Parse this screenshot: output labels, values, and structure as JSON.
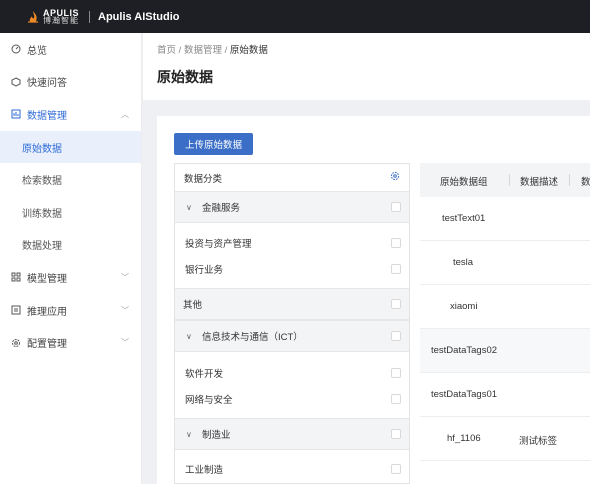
{
  "topbar": {
    "logo_en": "APULIS",
    "logo_cn": "博瀚智能",
    "app_title": "Apulis AIStudio"
  },
  "sidebar": {
    "items": [
      {
        "label": "总览",
        "icon": "dashboard-icon"
      },
      {
        "label": "快速问答",
        "icon": "chat-icon"
      },
      {
        "label": "数据管理",
        "icon": "data-icon",
        "expanded": true
      },
      {
        "label": "原始数据",
        "sub": true,
        "selected": true
      },
      {
        "label": "检索数据",
        "sub": true
      },
      {
        "label": "训练数据",
        "sub": true
      },
      {
        "label": "数据处理",
        "sub": true
      },
      {
        "label": "模型管理",
        "icon": "model-icon"
      },
      {
        "label": "推理应用",
        "icon": "inference-icon"
      },
      {
        "label": "配置管理",
        "icon": "settings-icon"
      }
    ]
  },
  "breadcrumb": {
    "home": "首页",
    "sep": "/",
    "parent": "数据管理",
    "current": "原始数据"
  },
  "page_title": "原始数据",
  "upload_button": "上传原始数据",
  "category_panel": {
    "header": "数据分类",
    "rows": [
      {
        "label": "金融服务",
        "type": "group"
      },
      {
        "label": "投资与资产管理",
        "type": "item"
      },
      {
        "label": "银行业务",
        "type": "item"
      },
      {
        "label": "其他",
        "type": "group-plain"
      },
      {
        "label": "信息技术与通信（ICT）",
        "type": "group"
      },
      {
        "label": "软件开发",
        "type": "item"
      },
      {
        "label": "网络与安全",
        "type": "item"
      },
      {
        "label": "制造业",
        "type": "group"
      },
      {
        "label": "工业制造",
        "type": "item"
      }
    ]
  },
  "table": {
    "columns": [
      "原始数据组",
      "数据描述",
      "数"
    ],
    "rows": [
      {
        "name": "testText01",
        "desc": ""
      },
      {
        "name": "tesla",
        "desc": ""
      },
      {
        "name": "xiaomi",
        "desc": ""
      },
      {
        "name": "testDataTags02",
        "desc": ""
      },
      {
        "name": "testDataTags01",
        "desc": ""
      },
      {
        "name": "hf_1106",
        "desc": "测试标签"
      }
    ]
  },
  "colors": {
    "accent": "#3b6fc7",
    "topbar": "#1d1f24",
    "selected_bg": "#e9f0fc"
  }
}
